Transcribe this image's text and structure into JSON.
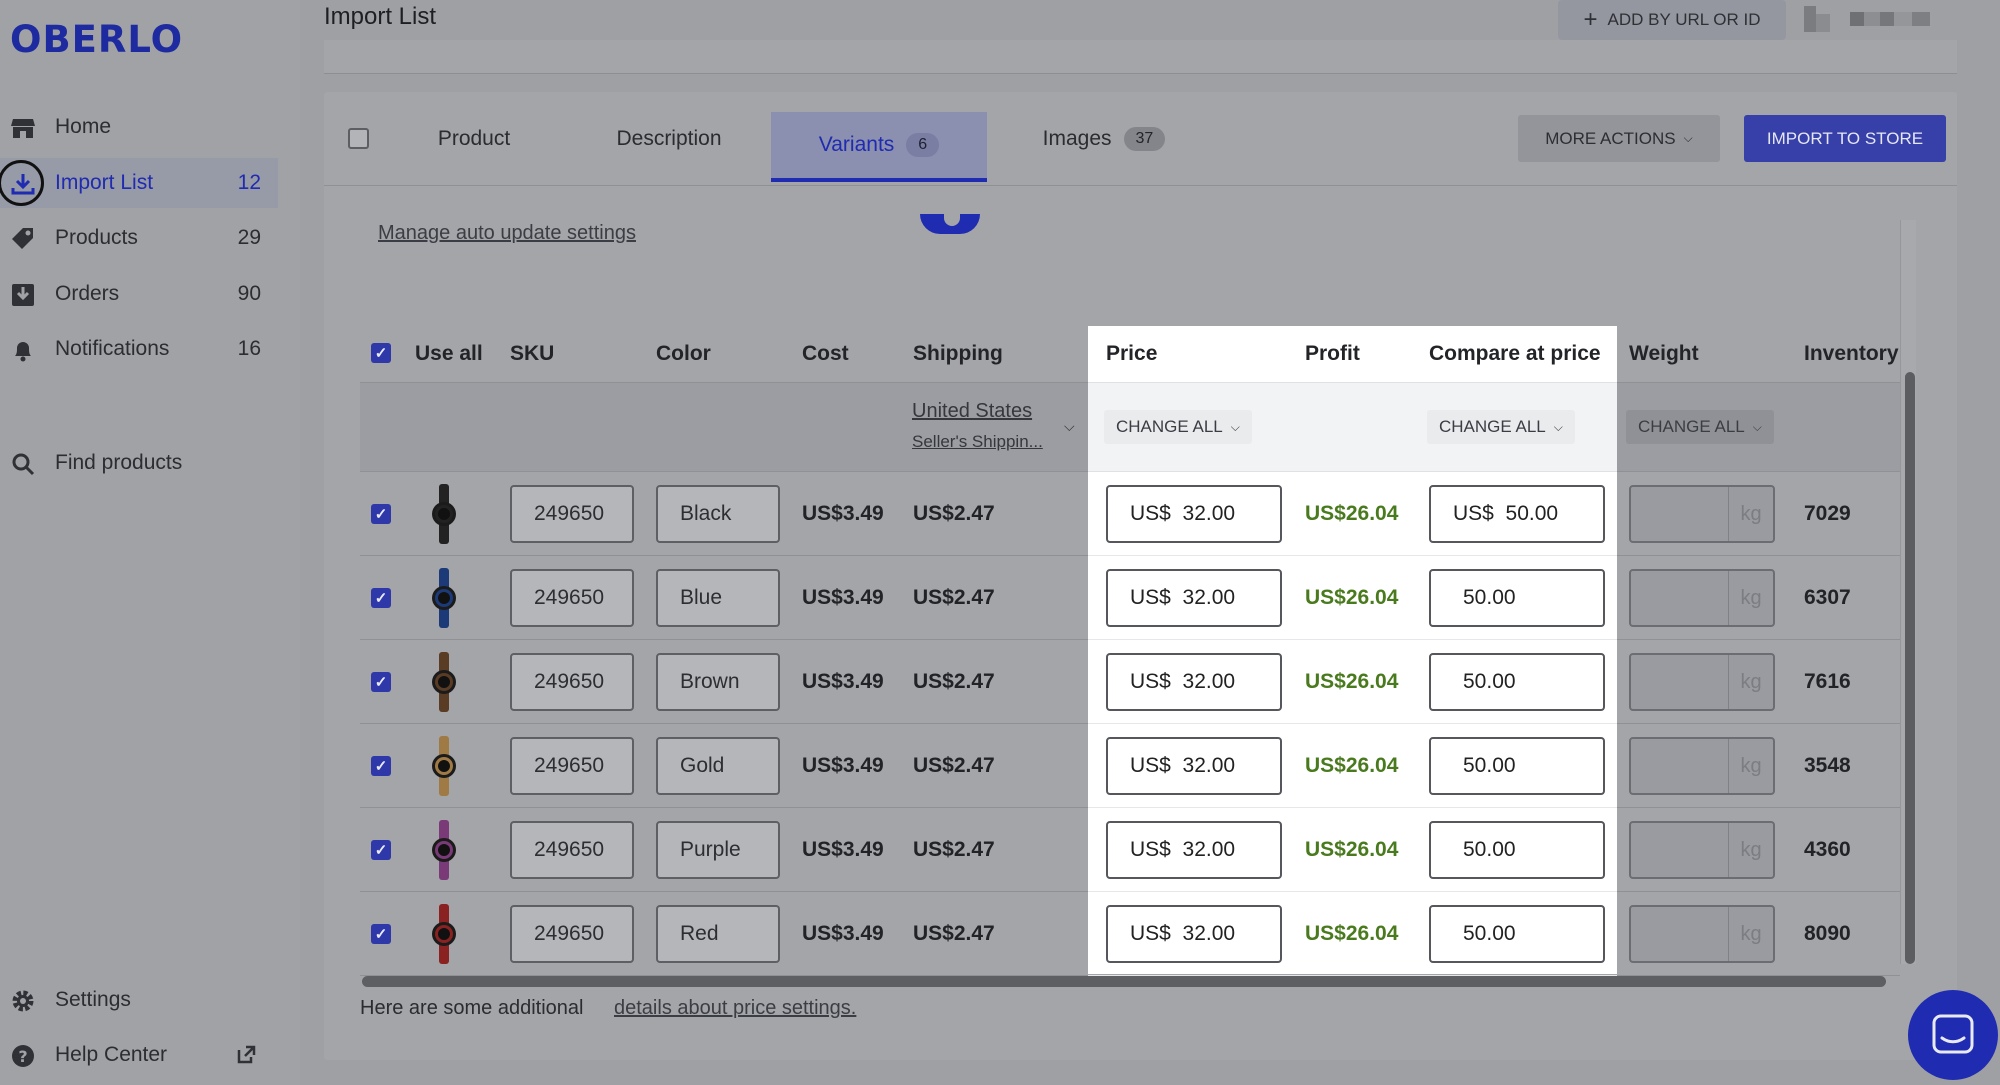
{
  "app": {
    "logo": "OBERLO",
    "accent": "#1f2bb0",
    "profit_color": "#4a7a1e"
  },
  "header": {
    "title": "Import List",
    "add_by_url": "ADD BY URL OR ID"
  },
  "sidebar": {
    "items": [
      {
        "label": "Home",
        "count": "",
        "icon": "store-icon"
      },
      {
        "label": "Import List",
        "count": "12",
        "icon": "download-icon",
        "active": true
      },
      {
        "label": "Products",
        "count": "29",
        "icon": "tag-icon"
      },
      {
        "label": "Orders",
        "count": "90",
        "icon": "inbox-icon"
      },
      {
        "label": "Notifications",
        "count": "16",
        "icon": "bell-icon"
      },
      {
        "label": "Find products",
        "count": "",
        "icon": "search-icon"
      },
      {
        "label": "Settings",
        "count": "",
        "icon": "gear-icon"
      },
      {
        "label": "Help Center",
        "count": "",
        "icon": "help-icon"
      }
    ]
  },
  "tabs": [
    {
      "label": "Product",
      "badge": ""
    },
    {
      "label": "Description",
      "badge": ""
    },
    {
      "label": "Variants",
      "badge": "6",
      "active": true
    },
    {
      "label": "Images",
      "badge": "37"
    }
  ],
  "actions": {
    "more_actions": "MORE ACTIONS",
    "import_to_store": "IMPORT TO STORE"
  },
  "variants": {
    "manage_link": "Manage auto update settings",
    "columns": [
      "Use all",
      "SKU",
      "Color",
      "Cost",
      "Shipping",
      "Price",
      "Profit",
      "Compare at price",
      "Weight",
      "Inventory"
    ],
    "shipping": {
      "country": "United States",
      "method": "Seller's Shippin..."
    },
    "change_all": "CHANGE ALL",
    "currency_prefix": "US$",
    "weight_unit": "kg",
    "rows": [
      {
        "sku": "249650",
        "color": "Black",
        "cost": "US$3.49",
        "shipping": "US$2.47",
        "price": "32.00",
        "profit": "US$26.04",
        "compare_prefix": "US$",
        "compare": "50.00",
        "inventory": "7029",
        "watch_color": "#222"
      },
      {
        "sku": "249650",
        "color": "Blue",
        "cost": "US$3.49",
        "shipping": "US$2.47",
        "price": "32.00",
        "profit": "US$26.04",
        "compare_prefix": "",
        "compare": "50.00",
        "inventory": "6307",
        "watch_color": "#1c3a78"
      },
      {
        "sku": "249650",
        "color": "Brown",
        "cost": "US$3.49",
        "shipping": "US$2.47",
        "price": "32.00",
        "profit": "US$26.04",
        "compare_prefix": "",
        "compare": "50.00",
        "inventory": "7616",
        "watch_color": "#5a3b23"
      },
      {
        "sku": "249650",
        "color": "Gold",
        "cost": "US$3.49",
        "shipping": "US$2.47",
        "price": "32.00",
        "profit": "US$26.04",
        "compare_prefix": "",
        "compare": "50.00",
        "inventory": "3548",
        "watch_color": "#a07a45"
      },
      {
        "sku": "249650",
        "color": "Purple",
        "cost": "US$3.49",
        "shipping": "US$2.47",
        "price": "32.00",
        "profit": "US$26.04",
        "compare_prefix": "",
        "compare": "50.00",
        "inventory": "4360",
        "watch_color": "#7a3a78"
      },
      {
        "sku": "249650",
        "color": "Red",
        "cost": "US$3.49",
        "shipping": "US$2.47",
        "price": "32.00",
        "profit": "US$26.04",
        "compare_prefix": "",
        "compare": "50.00",
        "inventory": "8090",
        "watch_color": "#8a2222"
      }
    ],
    "footer_text": "Here are some additional",
    "footer_link": "details about price settings."
  }
}
